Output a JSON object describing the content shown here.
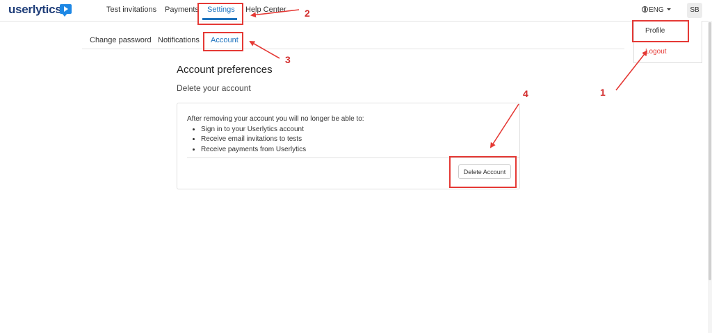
{
  "app": {
    "logo_text": "userlytics"
  },
  "topnav": {
    "items": [
      {
        "label": "Test invitations"
      },
      {
        "label": "Payments"
      },
      {
        "label": "Settings",
        "active": true
      },
      {
        "label": "Help Center"
      }
    ],
    "language": "ENG",
    "avatar_initials": "SB"
  },
  "user_menu": {
    "items": [
      {
        "label": "Profile",
        "color": "#333333"
      },
      {
        "label": "Logout",
        "color": "#e53935"
      }
    ]
  },
  "subtabs": {
    "items": [
      {
        "label": "Change password"
      },
      {
        "label": "Notifications"
      },
      {
        "label": "Account",
        "active": true
      }
    ]
  },
  "page": {
    "title": "Account preferences",
    "section_title": "Delete your account",
    "card": {
      "intro": "After removing your account you will no longer be able to:",
      "bullets": [
        "Sign in to your Userlytics account",
        "Receive email invitations to tests",
        "Receive payments from Userlytics"
      ],
      "delete_button": "Delete Account"
    }
  },
  "annotations": {
    "accent_color": "#e53935",
    "numbers": [
      "1",
      "2",
      "3",
      "4"
    ]
  }
}
